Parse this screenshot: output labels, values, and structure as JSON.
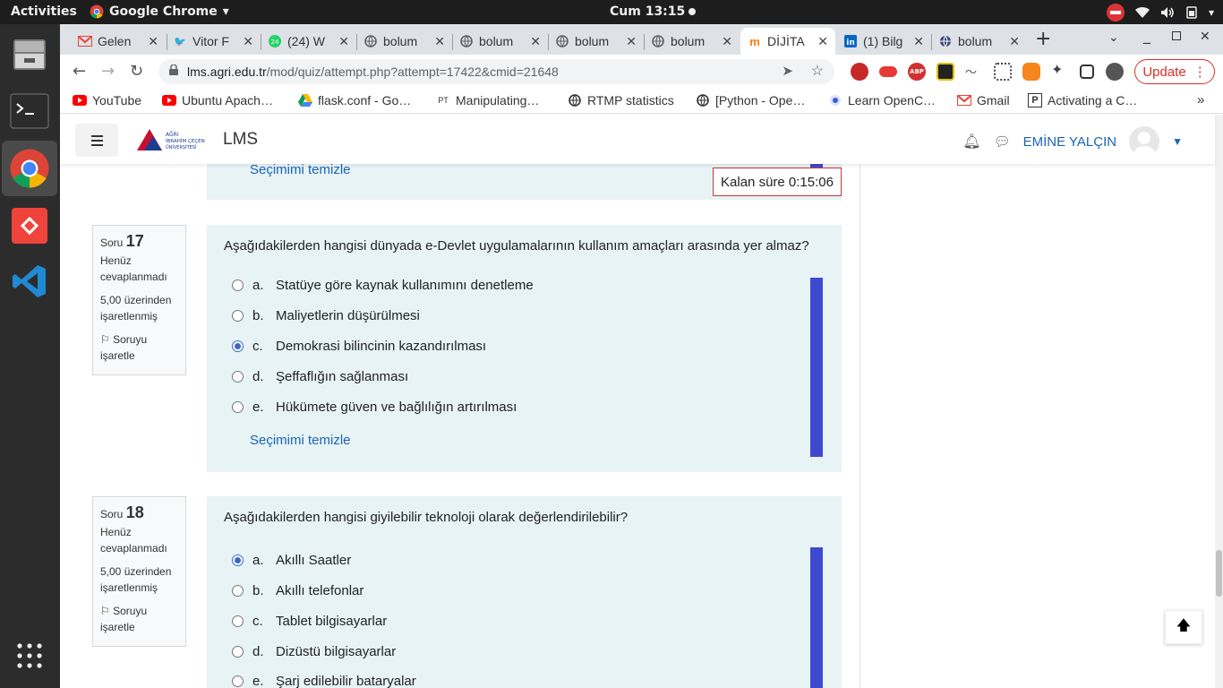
{
  "system": {
    "activities": "Activities",
    "app_name": "Google Chrome",
    "clock": "Cum 13:15"
  },
  "tabs": [
    {
      "title": "Gelen",
      "icon": "gmail-icon"
    },
    {
      "title": "Vitor F",
      "icon": "twitter-icon"
    },
    {
      "title": "(24) W",
      "icon": "whatsapp-icon"
    },
    {
      "title": "bolum",
      "icon": "globe-icon"
    },
    {
      "title": "bolum",
      "icon": "globe-icon"
    },
    {
      "title": "bolum",
      "icon": "globe-icon"
    },
    {
      "title": "bolum",
      "icon": "globe-icon"
    },
    {
      "title": "DİJİTA",
      "icon": "moodle-icon"
    },
    {
      "title": "(1) Bilg",
      "icon": "linkedin-icon"
    },
    {
      "title": "bolum",
      "icon": "globe-icon"
    }
  ],
  "address": {
    "domain": "lms.agri.edu.tr",
    "path": "/mod/quiz/attempt.php?attempt=17422&cmid=21648"
  },
  "update_label": "Update",
  "bookmarks": [
    {
      "label": "YouTube",
      "icon": "youtube-icon"
    },
    {
      "label": "Ubuntu Apach…",
      "icon": "youtube-icon"
    },
    {
      "label": "flask.conf - Go…",
      "icon": "drive-icon"
    },
    {
      "label": "Manipulating…",
      "icon": "pt-icon"
    },
    {
      "label": "RTMP statistics",
      "icon": "globe-icon"
    },
    {
      "label": "[Python - Ope…",
      "icon": "globe-icon"
    },
    {
      "label": "Learn OpenC…",
      "icon": "opencv-icon"
    },
    {
      "label": "Gmail",
      "icon": "gmail-icon"
    },
    {
      "label": "Activating a C…",
      "icon": "p-icon"
    }
  ],
  "site": {
    "logo_text": "AĞRI İBRAHİM ÇEÇEN ÜNİVERSİTESİ",
    "title": "LMS",
    "user_name": "EMİNE YALÇIN"
  },
  "timer": "Kalan süre 0:15:06",
  "prev_clear": "Seçimimi temizle",
  "questions": [
    {
      "label": "Soru",
      "number": "17",
      "status": "Henüz cevaplanmadı",
      "marks": "5,00 üzerinden işaretlenmiş",
      "flag": "Soruyu işaretle",
      "text": "Aşağıdakilerden hangisi dünyada e-Devlet uygulamalarının kullanım amaçları arasında yer almaz?",
      "options": [
        {
          "letter": "a.",
          "text": "Statüye göre kaynak kullanımını denetleme",
          "selected": false
        },
        {
          "letter": "b.",
          "text": "Maliyetlerin düşürülmesi",
          "selected": false
        },
        {
          "letter": "c.",
          "text": "Demokrasi bilincinin kazandırılması",
          "selected": true
        },
        {
          "letter": "d.",
          "text": "Şeffaflığın sağlanması",
          "selected": false
        },
        {
          "letter": "e.",
          "text": "Hükümete güven ve bağlılığın artırılması",
          "selected": false
        }
      ],
      "clear": "Seçimimi temizle"
    },
    {
      "label": "Soru",
      "number": "18",
      "status": "Henüz cevaplanmadı",
      "marks": "5,00 üzerinden işaretlenmiş",
      "flag": "Soruyu işaretle",
      "text": "Aşağıdakilerden hangisi giyilebilir teknoloji olarak değerlendirilebilir?",
      "options": [
        {
          "letter": "a.",
          "text": "Akıllı Saatler",
          "selected": true
        },
        {
          "letter": "b.",
          "text": "Akıllı telefonlar",
          "selected": false
        },
        {
          "letter": "c.",
          "text": "Tablet bilgisayarlar",
          "selected": false
        },
        {
          "letter": "d.",
          "text": "Dizüstü bilgisayarlar",
          "selected": false
        },
        {
          "letter": "e.",
          "text": "Şarj edilebilir bataryalar",
          "selected": false
        }
      ]
    }
  ]
}
